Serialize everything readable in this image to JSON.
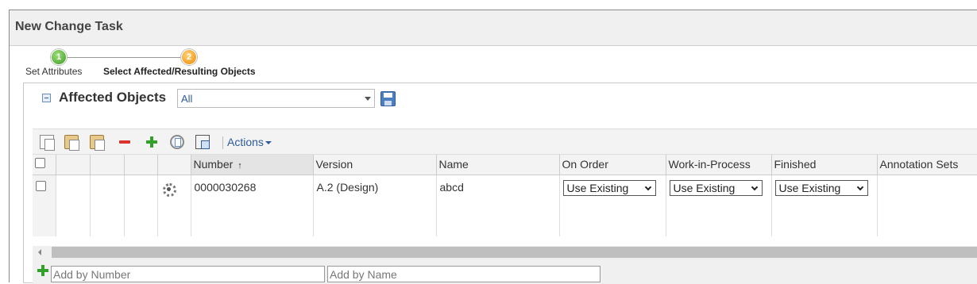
{
  "window": {
    "title": "New Change Task"
  },
  "wizard": {
    "steps": [
      {
        "number": "1",
        "label": "Set Attributes",
        "state": "complete",
        "color": "#3a9b1f"
      },
      {
        "number": "2",
        "label": "Select Affected/Resulting Objects",
        "state": "current",
        "color": "#f08a00"
      }
    ]
  },
  "panel": {
    "title": "Affected Objects",
    "view_select": "All",
    "toolbar": {
      "icons": [
        "copy-icon",
        "paste-icon",
        "paste-special-icon",
        "remove-icon",
        "add-icon",
        "related-objects-icon",
        "set-attributes-icon"
      ],
      "actions_label": "Actions"
    },
    "columns": [
      "",
      "",
      "",
      "",
      "",
      "Number",
      "Version",
      "Name",
      "On Order",
      "Work-in-Process",
      "Finished",
      "Annotation Sets"
    ],
    "sorted_column": "Number",
    "rows": [
      {
        "icon": "gear-icon",
        "number": "0000030268",
        "version": "A.2 (Design)",
        "name": "abcd",
        "on_order": "Use Existing",
        "work_in_process": "Use Existing",
        "finished": "Use Existing",
        "annotation_sets": ""
      }
    ],
    "add_by_number_placeholder": "Add by Number",
    "add_by_name_placeholder": "Add by Name"
  },
  "colors": {
    "accent_link": "#2b5a9a",
    "remove": "#d9342b",
    "add": "#33a02c"
  }
}
